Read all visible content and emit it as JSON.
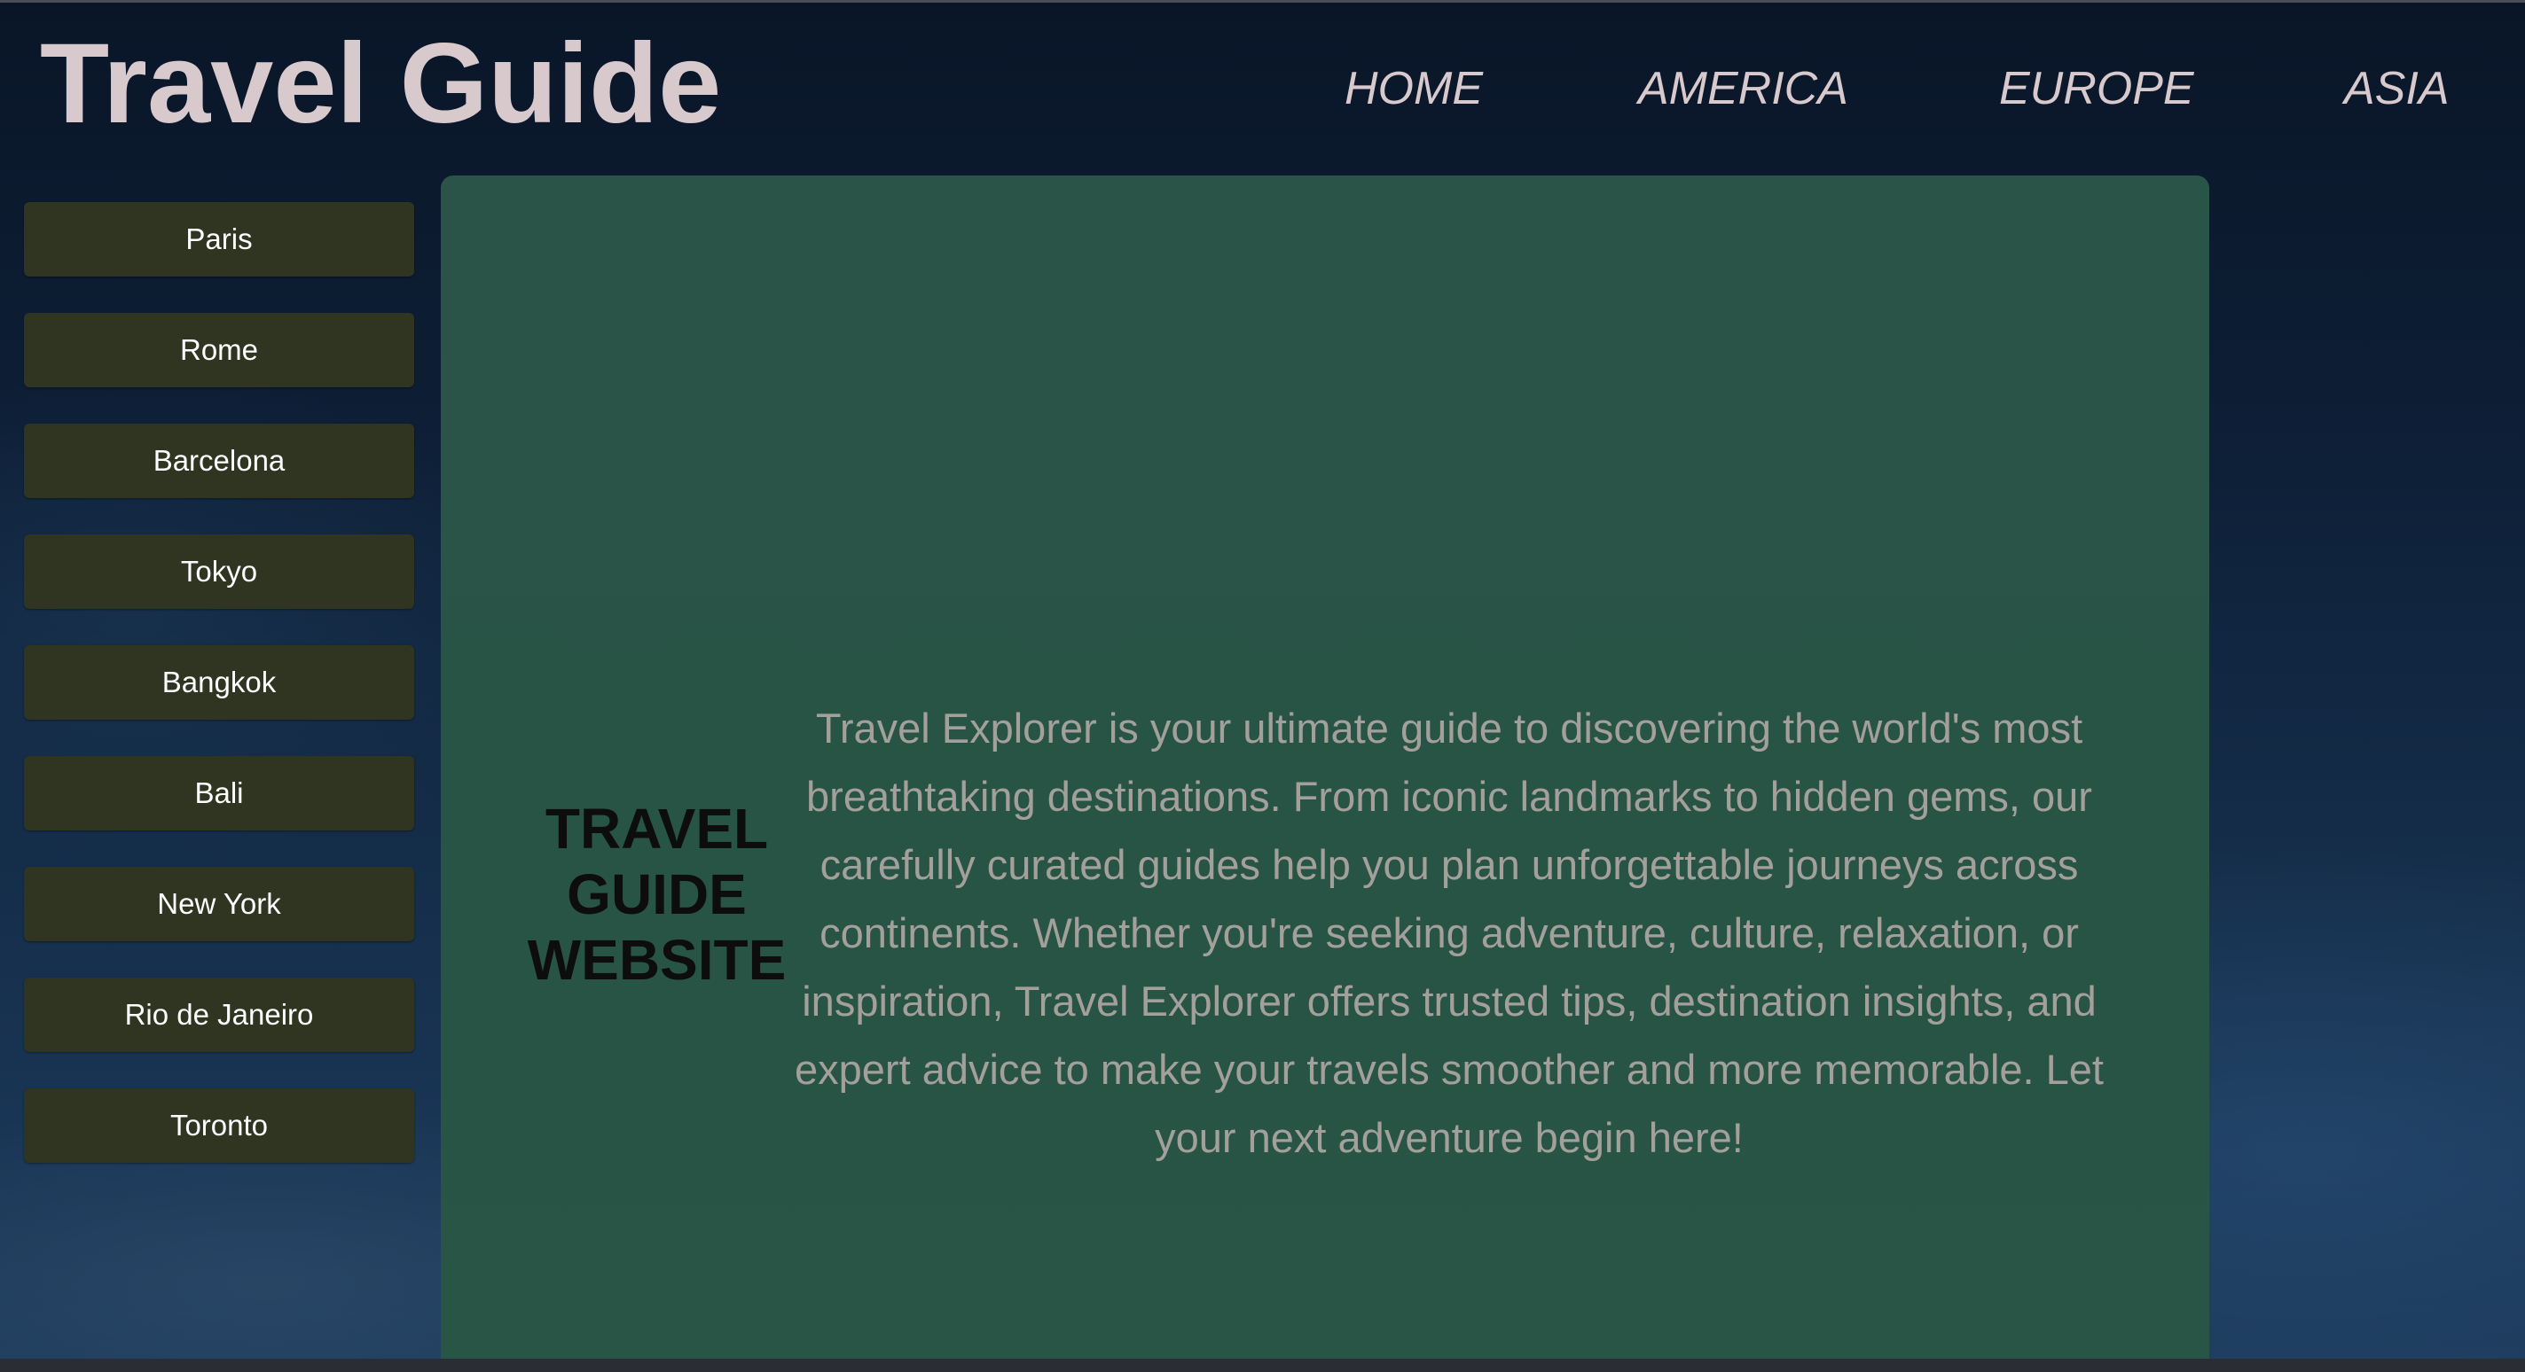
{
  "header": {
    "title": "Travel Guide",
    "nav": [
      "HOME",
      "AMERICA",
      "EUROPE",
      "ASIA"
    ]
  },
  "sidebar": {
    "cities": [
      "Paris",
      "Rome",
      "Barcelona",
      "Tokyo",
      "Bangkok",
      "Bali",
      "New York",
      "Rio de Janeiro",
      "Toronto"
    ]
  },
  "main": {
    "heading": [
      "TRAVEL",
      "GUIDE",
      "WEBSITE"
    ],
    "description": "Travel Explorer is your ultimate guide to discovering the world's most breathtaking destinations. From iconic landmarks to hidden gems, our carefully curated guides help you plan unforgettable journeys across continents. Whether you're seeking adventure, culture, relaxation, or inspiration, Travel Explorer offers trusted tips, destination insights, and expert advice to make your travels smoother and more memorable. Let your next adventure begin here!"
  },
  "colors": {
    "title_text": "#d8c9cd",
    "button_bg": "#2f3520",
    "panel_bg": "#285446",
    "panel_text": "#a3a09c",
    "page_bg": "#0d1e35"
  }
}
